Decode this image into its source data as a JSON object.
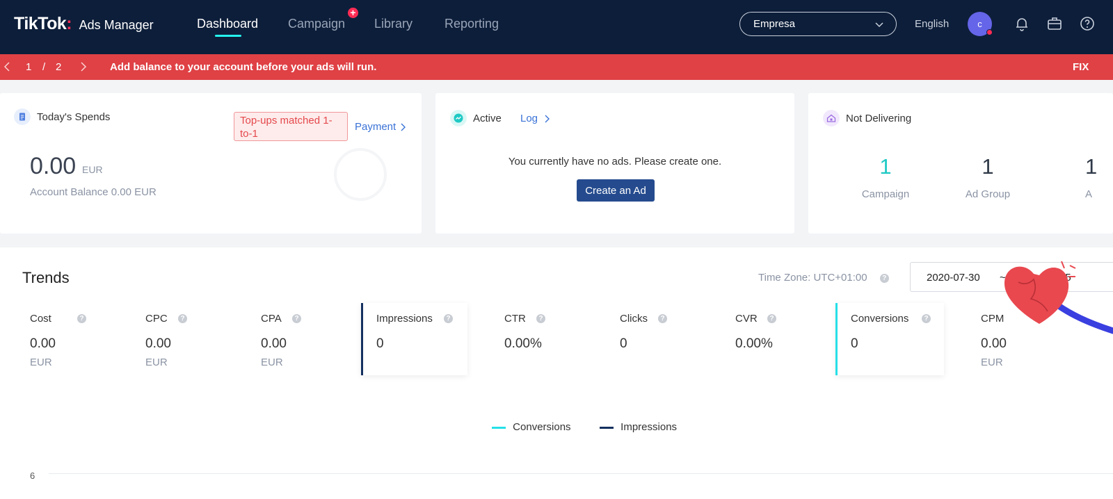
{
  "header": {
    "logo_brand": "TikTok",
    "logo_colon": ":",
    "logo_product": "Ads Manager",
    "nav": [
      {
        "label": "Dashboard",
        "active": true
      },
      {
        "label": "Campaign",
        "active": false
      },
      {
        "label": "Library",
        "active": false
      },
      {
        "label": "Reporting",
        "active": false
      }
    ],
    "campaign_badge": "+",
    "account": "Empresa",
    "language": "English",
    "avatar_initial": "c",
    "icons": [
      "bell-icon",
      "briefcase-icon",
      "help-icon"
    ]
  },
  "alert": {
    "current_page": "1",
    "separator": "/",
    "total_pages": "2",
    "message": "Add balance to your account before your ads will run.",
    "action": "FIX"
  },
  "cards": {
    "spends": {
      "title": "Today's Spends",
      "tag": "Top-ups matched 1-to-1",
      "payment_link": "Payment",
      "amount": "0.00",
      "currency": "EUR",
      "balance": "Account Balance 0.00 EUR"
    },
    "active": {
      "title": "Active",
      "log_link": "Log",
      "empty_message": "You currently have no ads. Please create one.",
      "create_button": "Create an Ad"
    },
    "not_delivering": {
      "title": "Not Delivering",
      "stats": [
        {
          "value": "1",
          "label": "Campaign"
        },
        {
          "value": "1",
          "label": "Ad Group"
        },
        {
          "value": "1",
          "label": "A"
        }
      ]
    }
  },
  "trends": {
    "title": "Trends",
    "timezone": "Time Zone: UTC+01:00",
    "date_start": "2020-07-30",
    "date_sep": "~",
    "date_end_partial": "05",
    "metrics": [
      {
        "name": "Cost",
        "value": "0.00",
        "unit": "EUR",
        "selected": false
      },
      {
        "name": "CPC",
        "value": "0.00",
        "unit": "EUR",
        "selected": false
      },
      {
        "name": "CPA",
        "value": "0.00",
        "unit": "EUR",
        "selected": false
      },
      {
        "name": "Impressions",
        "value": "0",
        "unit": "",
        "selected": true
      },
      {
        "name": "CTR",
        "value": "0.00%",
        "unit": "",
        "selected": false
      },
      {
        "name": "Clicks",
        "value": "0",
        "unit": "",
        "selected": false
      },
      {
        "name": "CVR",
        "value": "0.00%",
        "unit": "",
        "selected": false
      },
      {
        "name": "Conversions",
        "value": "0",
        "unit": "",
        "selected": true
      },
      {
        "name": "CPM",
        "value": "0.00",
        "unit": "EUR",
        "selected": false
      }
    ],
    "legend": [
      {
        "name": "Conversions",
        "color": "#25e0e8"
      },
      {
        "name": "Impressions",
        "color": "#14305f"
      }
    ],
    "y_tick": "6"
  },
  "colors": {
    "nav_bg": "#0d1e3a",
    "alert_bg": "#df4145",
    "accent_cyan": "#25f4ee",
    "button_blue": "#254b8e",
    "link_blue": "#3a72d6"
  }
}
